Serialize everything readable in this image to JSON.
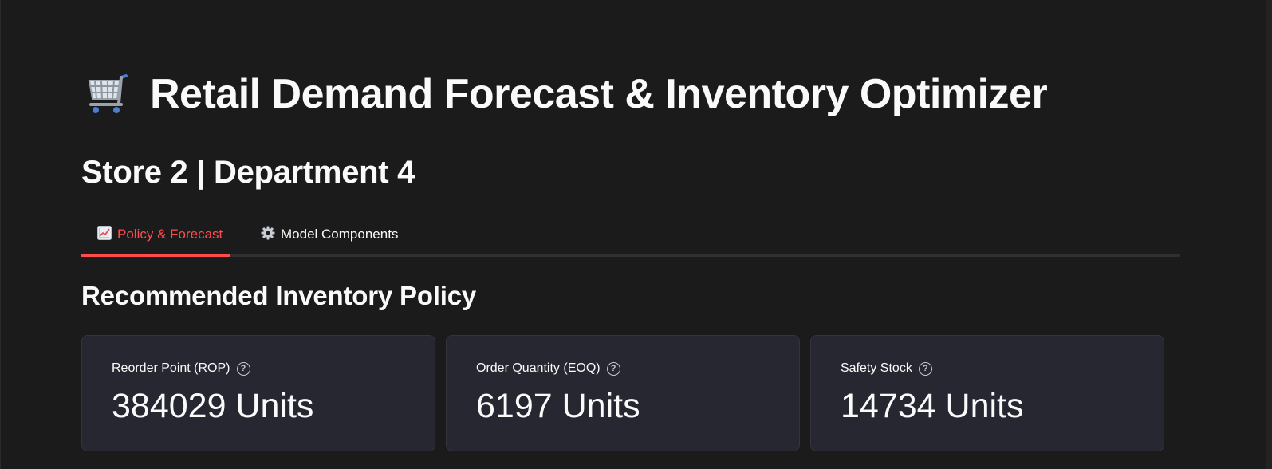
{
  "app": {
    "title": "Retail Demand Forecast & Inventory Optimizer",
    "title_icon": "shopping-cart-icon"
  },
  "header": {
    "subheader": "Store 2 | Department 4"
  },
  "tabs": [
    {
      "label": "Policy & Forecast",
      "icon": "chart-increasing-icon",
      "active": true
    },
    {
      "label": "Model Components",
      "icon": "gear-icon",
      "active": false
    }
  ],
  "policy": {
    "section_title": "Recommended Inventory Policy",
    "metrics": [
      {
        "label": "Reorder Point (ROP)",
        "value": "384029 Units",
        "help_icon": "question-circle-icon"
      },
      {
        "label": "Order Quantity (EOQ)",
        "value": "6197 Units",
        "help_icon": "question-circle-icon"
      },
      {
        "label": "Safety Stock",
        "value": "14734 Units",
        "help_icon": "question-circle-icon"
      }
    ]
  },
  "colors": {
    "background": "#1b1b1b",
    "accent": "#ff4b4b",
    "card": "#262730",
    "text": "#fafafa"
  }
}
